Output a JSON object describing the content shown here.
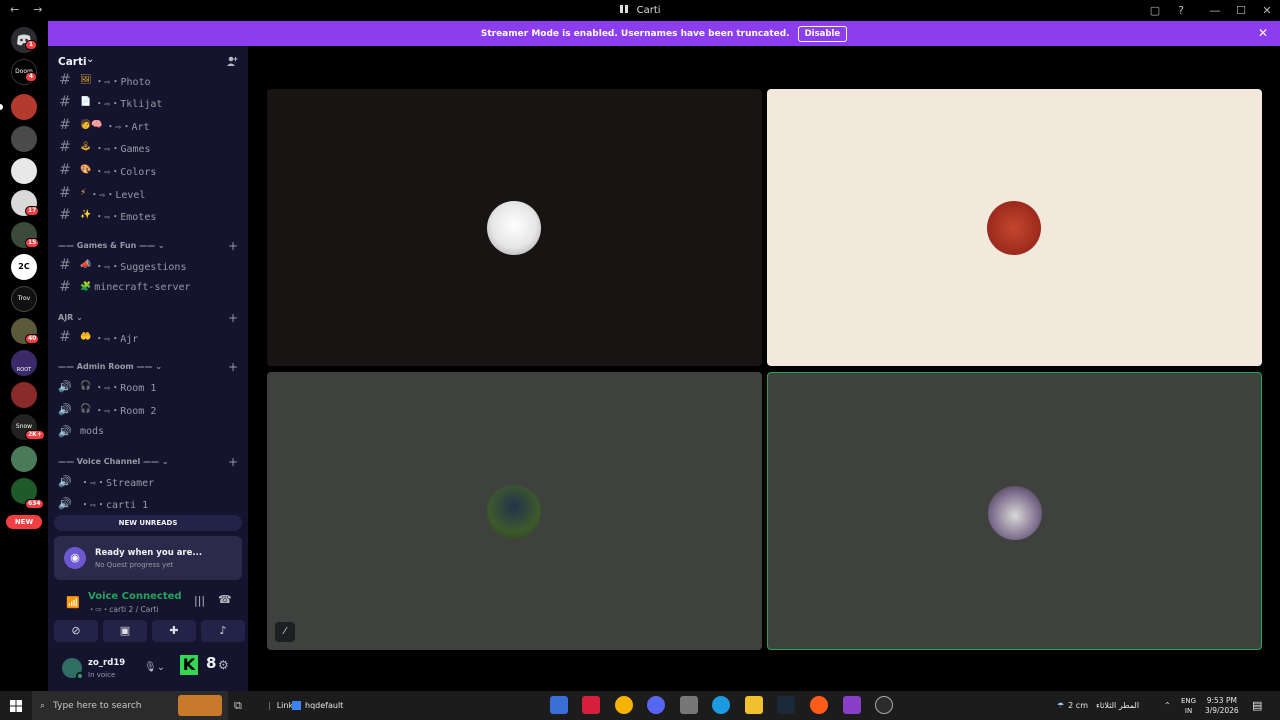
{
  "window": {
    "title": "Carti",
    "nav_back": "←",
    "nav_forward": "→",
    "controls": [
      "▢",
      "?",
      "—",
      "☐",
      "✕"
    ]
  },
  "banner": {
    "text": "Streamer Mode is enabled. Usernames have been truncated.",
    "button": "Disable",
    "close": "✕"
  },
  "servers": {
    "badges": [
      "1",
      "4",
      "17",
      "15",
      "40",
      "2K+",
      "634"
    ],
    "labels": [
      "Doom",
      "2C",
      "Trov",
      "ROOT",
      "Snow"
    ],
    "new_label": "NEW"
  },
  "guild": {
    "name": "Carti",
    "chevron": "⌄",
    "invite_icon": "person-add-icon"
  },
  "channels": [
    {
      "name": "・⇨・Photo",
      "emoji": "🖼"
    },
    {
      "name": "・⇨・Tklijat",
      "emoji": "📄"
    },
    {
      "name": "・⇨・Art",
      "emoji": "🧑🧠"
    },
    {
      "name": "・⇨・Games",
      "emoji": "🕹"
    },
    {
      "name": "・⇨・Colors",
      "emoji": "🎨"
    },
    {
      "name": "・⇨・Level",
      "emoji": "⚡"
    },
    {
      "name": "・⇨・Emotes",
      "emoji": "✨"
    },
    {
      "name": "・⇨・Suggestions",
      "emoji": "📣"
    },
    {
      "name": "minecraft-server",
      "emoji": "🧩"
    },
    {
      "name": "・⇨・Ajr",
      "emoji": "🤲"
    }
  ],
  "categories": [
    {
      "name": "—— Games & Fun ——"
    },
    {
      "name": "AJR"
    },
    {
      "name": "—— Admin Room ——"
    },
    {
      "name": "—— Voice Channel ——"
    }
  ],
  "voice_channels": [
    {
      "name": "・⇨・Room 1",
      "emoji": "🎧"
    },
    {
      "name": "・⇨・Room 2",
      "emoji": "🎧"
    },
    {
      "name": "mods",
      "emoji": ""
    },
    {
      "name": "・⇨・Streamer",
      "emoji": ""
    },
    {
      "name": "・⇨・carti 1",
      "emoji": ""
    }
  ],
  "new_unreads": "NEW UNREADS",
  "quest": {
    "title": "Ready when you are...",
    "subtitle": "No Quest progress yet"
  },
  "voice": {
    "title": "Voice Connected",
    "subtitle": "・⇨・carti 2 / Carti"
  },
  "user": {
    "name": "zo_rd19",
    "status": "In voice",
    "k": "K",
    "eight": "8"
  },
  "taskbar": {
    "search_placeholder": "Type here to search",
    "links": "Links",
    "hqdefault": "hqdefault",
    "weather": "2 cm",
    "weather_ar": "المطر الثلاثاء",
    "lang_top": "ENG",
    "lang_bottom": "IN",
    "time": "9:53 PM",
    "date": "3/9/2026"
  },
  "colors": {
    "accent": "#8c3df0",
    "voice_green": "#23a55a",
    "sidebar": "#15142f"
  }
}
